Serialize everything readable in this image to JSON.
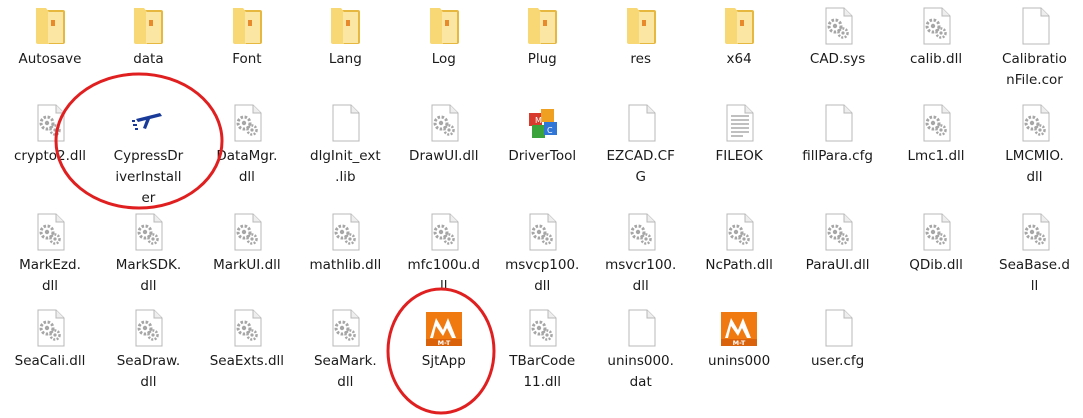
{
  "folder_items": [
    {
      "label": "Autosave",
      "icon": "folder-icon"
    },
    {
      "label": "data",
      "icon": "folder-icon"
    },
    {
      "label": "Font",
      "icon": "folder-icon"
    },
    {
      "label": "Lang",
      "icon": "folder-icon"
    },
    {
      "label": "Log",
      "icon": "folder-icon"
    },
    {
      "label": "Plug",
      "icon": "folder-icon"
    },
    {
      "label": "res",
      "icon": "folder-icon"
    },
    {
      "label": "x64",
      "icon": "folder-icon"
    },
    {
      "label": "CAD.sys",
      "icon": "system-file-gear-icon"
    },
    {
      "label": "calib.dll",
      "icon": "dll-gear-icon"
    },
    {
      "label": "Calibratio\nnFile.cor",
      "icon": "blank-file-icon"
    },
    {
      "label": "crypto2.dll",
      "icon": "dll-gear-icon"
    },
    {
      "label": "CypressDr\niverInstall\ner",
      "icon": "cypress-driver-installer-icon"
    },
    {
      "label": "DataMgr.\ndll",
      "icon": "dll-gear-icon"
    },
    {
      "label": "dlgInit_ext\n.lib",
      "icon": "blank-file-icon"
    },
    {
      "label": "DrawUI.dll",
      "icon": "dll-gear-icon"
    },
    {
      "label": "DriverTool",
      "icon": "mfc-cubes-app-icon"
    },
    {
      "label": "EZCAD.CF\nG",
      "icon": "blank-file-icon"
    },
    {
      "label": "FILEOK",
      "icon": "text-file-icon"
    },
    {
      "label": "fillPara.cfg",
      "icon": "blank-file-icon"
    },
    {
      "label": "Lmc1.dll",
      "icon": "dll-gear-icon"
    },
    {
      "label": "LMCMIO.\ndll",
      "icon": "dll-gear-icon"
    },
    {
      "label": "MarkEzd.\ndll",
      "icon": "dll-gear-icon"
    },
    {
      "label": "MarkSDK.\ndll",
      "icon": "dll-gear-icon"
    },
    {
      "label": "MarkUI.dll",
      "icon": "dll-gear-icon"
    },
    {
      "label": "mathlib.dll",
      "icon": "dll-gear-icon"
    },
    {
      "label": "mfc100u.d\nll",
      "icon": "dll-gear-icon"
    },
    {
      "label": "msvcp100.\ndll",
      "icon": "dll-gear-icon"
    },
    {
      "label": "msvcr100.\ndll",
      "icon": "dll-gear-icon"
    },
    {
      "label": "NcPath.dll",
      "icon": "dll-gear-icon"
    },
    {
      "label": "ParaUI.dll",
      "icon": "dll-gear-icon"
    },
    {
      "label": "QDib.dll",
      "icon": "dll-gear-icon"
    },
    {
      "label": "SeaBase.d\nll",
      "icon": "dll-gear-icon"
    },
    {
      "label": "SeaCali.dll",
      "icon": "dll-gear-icon"
    },
    {
      "label": "SeaDraw.\ndll",
      "icon": "dll-gear-icon"
    },
    {
      "label": "SeaExts.dll",
      "icon": "dll-gear-icon"
    },
    {
      "label": "SeaMark.\ndll",
      "icon": "dll-gear-icon"
    },
    {
      "label": "SjtApp",
      "icon": "mt-app-orange-icon",
      "badge": "M-T"
    },
    {
      "label": "TBarCode\n11.dll",
      "icon": "dll-gear-icon"
    },
    {
      "label": "unins000.\ndat",
      "icon": "blank-file-icon"
    },
    {
      "label": "unins000",
      "icon": "mt-app-orange-icon",
      "badge": "M-T"
    },
    {
      "label": "user.cfg",
      "icon": "blank-file-icon"
    }
  ],
  "colors": {
    "folder_light": "#f8d775",
    "folder_dark": "#e7b840",
    "highlight_circle": "#e02020",
    "mt_orange": "#f07a10"
  }
}
